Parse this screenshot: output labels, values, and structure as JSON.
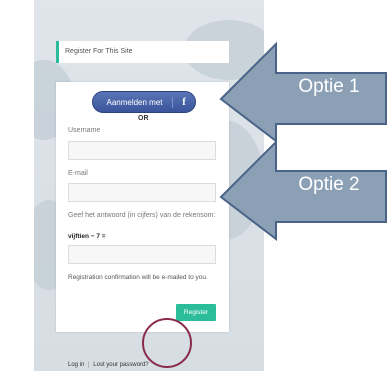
{
  "page": {
    "title": "Register For This Site"
  },
  "social": {
    "label": "Aanmelden met",
    "icon": "f"
  },
  "or_text": "OR",
  "form": {
    "username_label": "Username",
    "email_label": "E-mail",
    "captcha_label": "Geef het antwoord (in cijfers) van de rekensom:",
    "captcha_question": "vijftien − 7 =",
    "confirmation_text": "Registration confirmation will be e-mailed to you.",
    "register_button": "Register"
  },
  "footer": {
    "login": "Log in",
    "separator": "|",
    "lost_password": "Lost your password?"
  },
  "annotations": {
    "option1": "Optie 1",
    "option2": "Optie 2"
  },
  "colors": {
    "accent": "#2bbd9a",
    "facebook": "#3b5998",
    "arrow_fill": "#8b9fb5"
  }
}
